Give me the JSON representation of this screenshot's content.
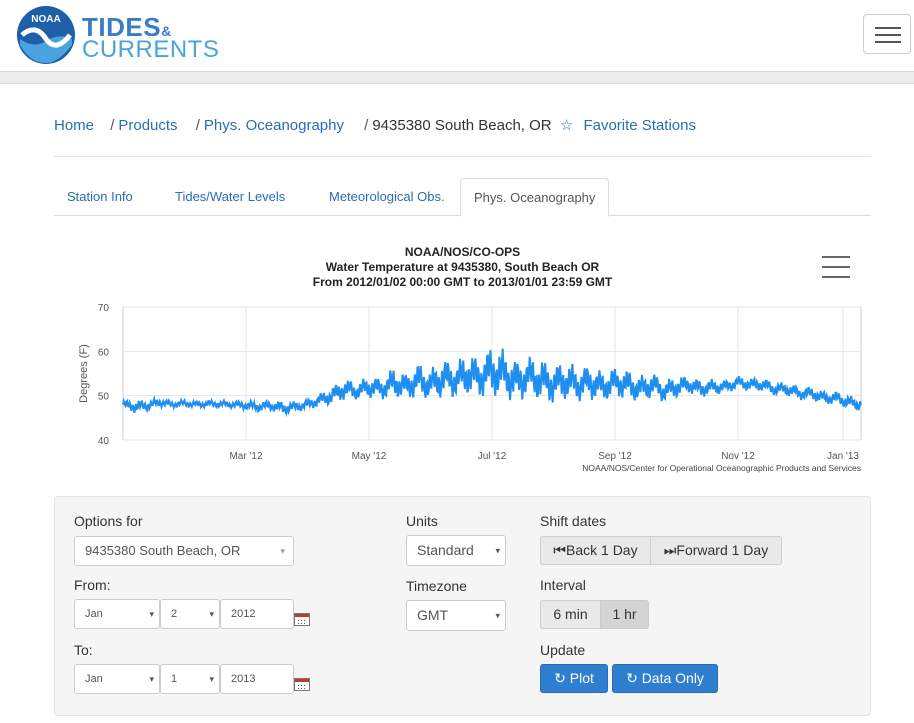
{
  "header": {
    "brand_line1": "TIDES",
    "brand_amp": "&",
    "brand_line2": "CURRENTS",
    "logo_text": "NOAA",
    "menu_icon": "hamburger-icon"
  },
  "breadcrumb": {
    "items": [
      "Home",
      "Products",
      "Phys. Oceanography"
    ],
    "current": "9435380 South Beach, OR",
    "favorite_label": "Favorite Stations",
    "favorite_icon": "star-outline-icon"
  },
  "tabs": [
    {
      "label": "Station Info",
      "active": false
    },
    {
      "label": "Tides/Water Levels",
      "active": false
    },
    {
      "label": "Meteorological Obs.",
      "active": false
    },
    {
      "label": "Phys. Oceanography",
      "active": true
    }
  ],
  "chart_data": {
    "type": "line",
    "title": "NOAA/NOS/CO-OPS",
    "subtitle1": "Water Temperature at 9435380, South Beach OR",
    "subtitle2": "From 2012/01/02 00:00 GMT to 2013/01/01 23:59 GMT",
    "ylabel": "Degrees (F)",
    "ylim": [
      40,
      70
    ],
    "yticks": [
      "70",
      "60",
      "50",
      "40"
    ],
    "xtick_labels": [
      "Mar '12",
      "May '12",
      "Jul '12",
      "Sep '12",
      "Nov '12",
      "Jan '13"
    ],
    "credit": "NOAA/NOS/Center for Operational Oceanographic Products and Services",
    "series_color": "#1f8ef1",
    "series": [
      {
        "x_month": [
          0.0,
          0.2,
          0.4,
          0.6,
          0.8,
          1.0,
          1.2,
          1.4,
          1.6,
          1.8,
          2.0,
          2.2,
          2.4,
          2.6,
          2.8,
          3.0,
          3.2,
          3.4,
          3.6,
          3.8,
          4.0,
          4.2,
          4.4,
          4.6,
          4.8,
          5.0,
          5.2,
          5.4,
          5.6,
          5.8,
          6.0,
          6.2,
          6.4,
          6.6,
          6.8,
          7.0,
          7.2,
          7.4,
          7.6,
          7.8,
          8.0,
          8.2,
          8.4,
          8.6,
          8.8,
          9.0,
          9.2,
          9.4,
          9.6,
          9.8,
          10.0,
          10.2,
          10.4,
          10.6,
          10.8,
          11.0,
          11.2,
          11.4,
          11.6,
          11.8,
          12.0
        ],
        "mid": [
          48.0,
          47.5,
          47.8,
          48.5,
          48.0,
          48.3,
          48.0,
          48.2,
          48.1,
          48.0,
          47.8,
          47.5,
          47.8,
          47.2,
          47.5,
          48.0,
          49.0,
          50.0,
          51.5,
          51.0,
          52.0,
          51.5,
          53.0,
          52.0,
          53.5,
          52.5,
          54.0,
          53.5,
          55.0,
          54.0,
          55.5,
          55.0,
          53.0,
          54.5,
          53.5,
          52.5,
          53.5,
          52.5,
          53.0,
          52.0,
          53.0,
          52.5,
          51.5,
          52.5,
          51.0,
          52.0,
          52.5,
          51.5,
          52.0,
          52.0,
          53.0,
          52.5,
          52.5,
          51.5,
          51.5,
          50.5,
          50.5,
          49.5,
          49.5,
          48.5,
          48.0
        ],
        "spread": [
          1.0,
          1.5,
          1.2,
          1.0,
          0.8,
          0.8,
          0.8,
          0.8,
          0.8,
          0.8,
          1.0,
          1.2,
          1.2,
          1.5,
          1.2,
          1.2,
          1.5,
          2.0,
          2.5,
          2.0,
          2.5,
          2.5,
          3.5,
          3.0,
          4.0,
          3.5,
          4.5,
          4.0,
          5.0,
          4.5,
          6.0,
          5.5,
          5.0,
          4.5,
          5.0,
          4.5,
          4.5,
          4.0,
          4.0,
          3.5,
          3.5,
          3.5,
          3.0,
          3.0,
          2.5,
          2.5,
          2.0,
          2.0,
          1.8,
          1.5,
          1.5,
          1.5,
          1.5,
          1.5,
          1.5,
          1.5,
          1.5,
          1.5,
          1.5,
          1.5,
          1.5
        ]
      }
    ]
  },
  "options": {
    "options_for_label": "Options for",
    "station_select": "9435380 South Beach, OR",
    "from_label": "From:",
    "from_month": "Jan",
    "from_day": "2",
    "from_year": "2012",
    "to_label": "To:",
    "to_month": "Jan",
    "to_day": "1",
    "to_year": "2013",
    "units_label": "Units",
    "units_value": "Standard",
    "timezone_label": "Timezone",
    "timezone_value": "GMT",
    "shift_label": "Shift dates",
    "back_label": "Back 1 Day",
    "forward_label": "Forward 1 Day",
    "interval_label": "Interval",
    "interval_6": "6 min",
    "interval_1h": "1 hr",
    "update_label": "Update",
    "plot_label": "Plot",
    "data_only_label": "Data Only"
  }
}
